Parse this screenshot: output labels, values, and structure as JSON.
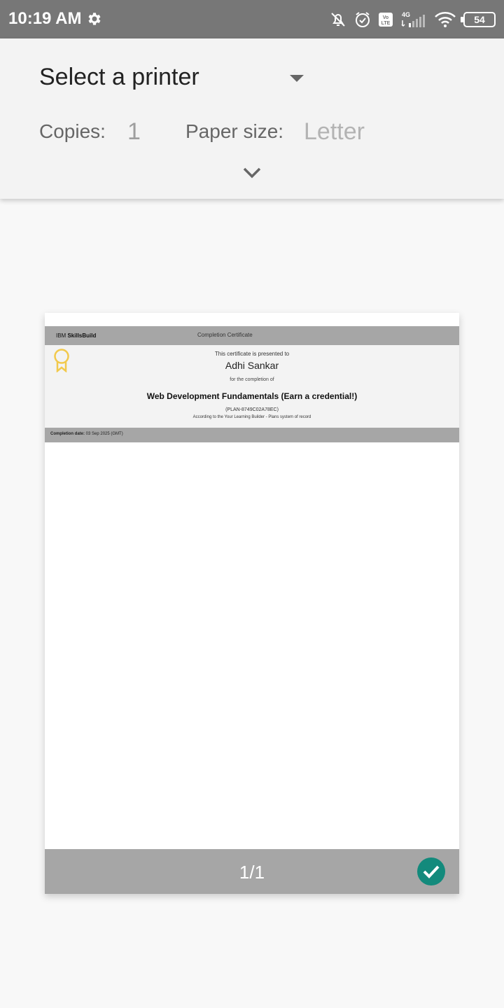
{
  "status_bar": {
    "time": "10:19 AM",
    "network": "4G",
    "volte": "Vo LTE",
    "battery": "54"
  },
  "print_options": {
    "printer": "Select a printer",
    "copies_label": "Copies:",
    "copies_value": "1",
    "paper_size_label": "Paper size:",
    "paper_size_value": "Letter"
  },
  "certificate": {
    "brand_prefix": "IBM",
    "brand_name": "SkillsBuild",
    "header_title": "Completion Certificate",
    "presented_text": "This certificate is presented to",
    "recipient": "Adhi Sankar",
    "for_completion_text": "for the completion of",
    "course": "Web Development Fundamentals (Earn a credential!)",
    "plan_id": "(PLAN-8749C02A78EC)",
    "system_text": "According to the Your Learning Builder - Plans system of record",
    "completion_label": "Completion date:",
    "completion_value": "03 Sep 2025 (GMT)"
  },
  "preview": {
    "page_indicator": "1/1"
  },
  "colors": {
    "status_bar": "#777777",
    "panel": "#f3f3f3",
    "cert_band": "#a6a6a6",
    "check_accent": "#138a7c",
    "ribbon": "#f2c94c"
  }
}
